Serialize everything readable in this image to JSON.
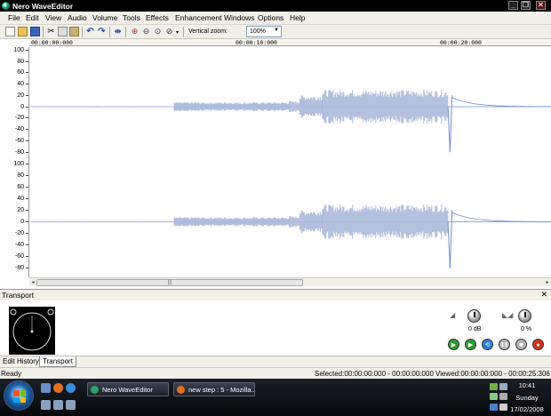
{
  "window": {
    "title": "Nero WaveEditor",
    "minimize": "_",
    "restore": "❐",
    "close": "✕"
  },
  "menu": [
    "File",
    "Edit",
    "View",
    "Audio",
    "Volume",
    "Tools",
    "Effects",
    "Enhancement",
    "Windows",
    "Options",
    "Help"
  ],
  "toolbar": {
    "icons": [
      "new-icon",
      "open-icon",
      "save-icon",
      "cut-icon",
      "copy-icon",
      "paste-icon",
      "undo-icon",
      "redo-icon",
      "split-icon",
      "zoom-in-icon",
      "zoom-out-icon",
      "zoom-fit-icon",
      "zoom-selection-icon"
    ],
    "vertical_zoom_label": "Vertical zoom:",
    "vertical_zoom_value": "100%",
    "dropdown_arrow": "▼"
  },
  "ruler": {
    "labels": [
      "00:00:00:000",
      "00:00:10:000",
      "00:00:20:000"
    ]
  },
  "channels": [
    {
      "ticks": [
        "100",
        "80",
        "60",
        "40",
        "20",
        "0",
        "-20",
        "-40",
        "-60",
        "-80"
      ]
    },
    {
      "ticks": [
        "100",
        "80",
        "60",
        "40",
        "20",
        "0",
        "-20",
        "-40",
        "-60",
        "-80"
      ]
    }
  ],
  "waveform": {
    "color": "#a9b9db",
    "line_color": "#6d8fd2",
    "segments": [
      {
        "t_start": 0.0,
        "t_end": 7.0,
        "amplitude": 1
      },
      {
        "t_start": 7.0,
        "t_end": 12.6,
        "amplitude": 8
      },
      {
        "t_start": 12.6,
        "t_end": 13.1,
        "amplitude": 10
      },
      {
        "t_start": 13.1,
        "t_end": 14.2,
        "amplitude": 20
      },
      {
        "t_start": 14.2,
        "t_end": 20.3,
        "amplitude": 30
      },
      {
        "t_start": 20.3,
        "t_end": 20.5,
        "amplitude": -80
      },
      {
        "t_start": 20.5,
        "t_end": 25.3,
        "amplitude": 5
      }
    ]
  },
  "scrollbar": {
    "left_arrow": "◂",
    "right_arrow": "▸",
    "thumb_grip": "|||"
  },
  "transport": {
    "title": "Transport",
    "close": "✕",
    "volume_value": "0 dB",
    "balance_value": "0 %",
    "buttons": [
      {
        "name": "play-button",
        "glyph": "▶",
        "color": "#2e9b2e"
      },
      {
        "name": "play-selection-button",
        "glyph": "▶",
        "color": "#2e9b2e"
      },
      {
        "name": "loop-button",
        "glyph": "⟲",
        "color": "#2c7fd3"
      },
      {
        "name": "pause-button",
        "glyph": "❚❚",
        "color": "#b5b5b5"
      },
      {
        "name": "stop-button",
        "glyph": "■",
        "color": "#b5b5b5"
      },
      {
        "name": "record-button",
        "glyph": "●",
        "color": "#d0321c"
      }
    ]
  },
  "tabs": [
    {
      "label": "Edit History",
      "active": false
    },
    {
      "label": "Transport",
      "active": true
    }
  ],
  "status": {
    "left": "Ready",
    "selected": "Selected:00:00:00:000 - 00:00:00:000",
    "viewed": "Viewed:00:00:00:000 - 00:00:25:306"
  },
  "taskbar": {
    "items": [
      {
        "label": "Nero WaveEditor",
        "icon_color": "#2ea06b"
      },
      {
        "label": "new step : 5 - Mozilla...",
        "icon_color": "#e07020"
      }
    ],
    "clock": {
      "time": "10:41",
      "day": "Sunday",
      "date": "17/02/2008"
    }
  }
}
